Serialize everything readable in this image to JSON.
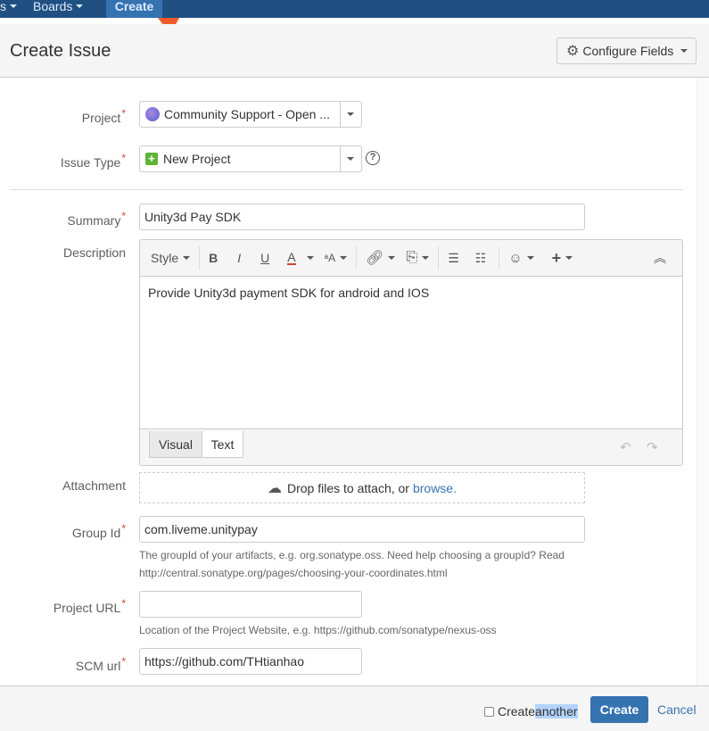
{
  "nav": {
    "partial_label": "s",
    "boards_label": "Boards",
    "create_label": "Create"
  },
  "dialog": {
    "title": "Create Issue",
    "configure_fields_label": "Configure Fields"
  },
  "fields": {
    "project": {
      "label": "Project",
      "value": "Community Support - Open ..."
    },
    "issue_type": {
      "label": "Issue Type",
      "value": "New Project"
    },
    "summary": {
      "label": "Summary",
      "value": "Unity3d Pay SDK"
    },
    "description": {
      "label": "Description",
      "value": "Provide Unity3d payment SDK for android and IOS",
      "toolbar": {
        "style_label": "Style"
      },
      "tabs": {
        "visual": "Visual",
        "text": "Text"
      }
    },
    "attachment": {
      "label": "Attachment",
      "drop_text": "Drop files to attach, or",
      "browse_link": "browse."
    },
    "group_id": {
      "label": "Group Id",
      "value": "com.liveme.unitypay",
      "help_line1": "The groupId of your artifacts, e.g. org.sonatype.oss. Need help choosing a groupId? Read",
      "help_line2": "http://central.sonatype.org/pages/choosing-your-coordinates.html"
    },
    "project_url": {
      "label": "Project URL",
      "value": "",
      "help": "Location of the Project Website, e.g. https://github.com/sonatype/nexus-oss"
    },
    "scm_url": {
      "label": "SCM url",
      "value": "https://github.com/THtianhao"
    }
  },
  "footer": {
    "create_another_prefix": "Create ",
    "create_another_highlight": "another",
    "create_button": "Create",
    "cancel_link": "Cancel"
  },
  "colors": {
    "nav_bg": "#205081",
    "primary": "#3572b0",
    "required": "#d04437",
    "link": "#3b73af",
    "annotation_arrow": "#f05a28"
  }
}
